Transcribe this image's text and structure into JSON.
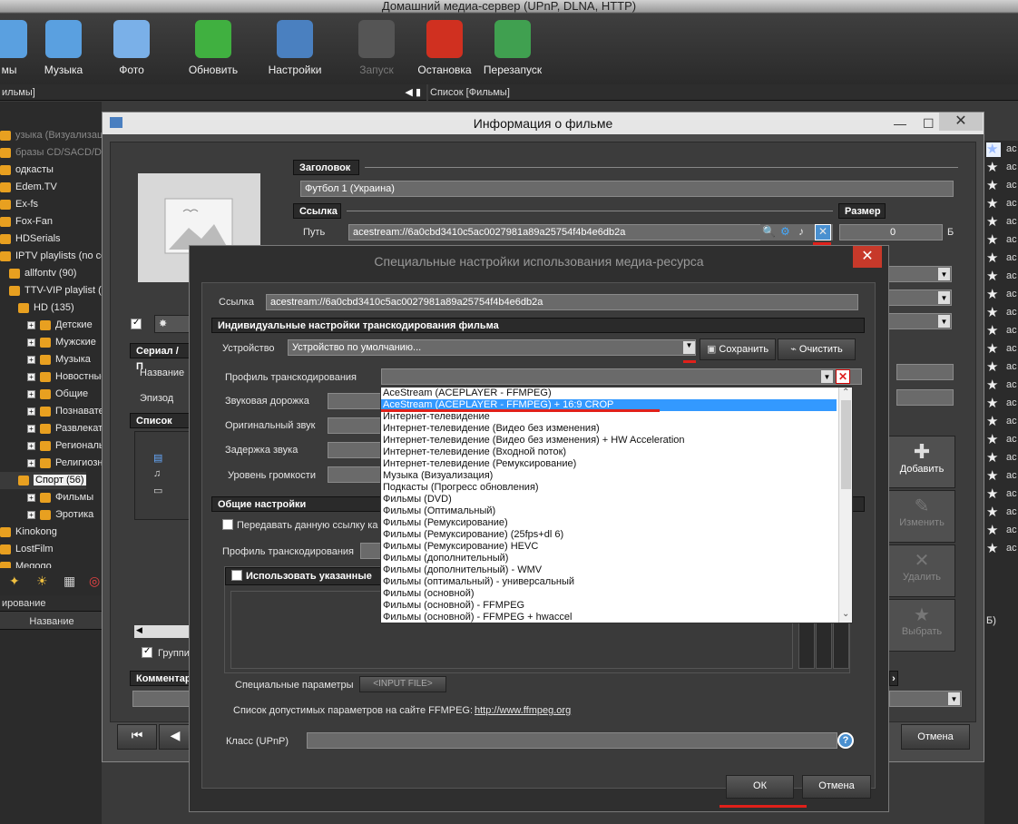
{
  "app_title": "Домашний медиа-сервер (UPnP, DLNA, HTTP)",
  "toolbar": [
    {
      "label": "мы",
      "disabled": false
    },
    {
      "label": "Музыка",
      "disabled": false
    },
    {
      "label": "Фото",
      "disabled": false
    },
    {
      "label": "Обновить",
      "disabled": false
    },
    {
      "label": "Настройки",
      "disabled": false
    },
    {
      "label": "Запуск",
      "disabled": true
    },
    {
      "label": "Остановка",
      "disabled": false
    },
    {
      "label": "Перезапуск",
      "disabled": false
    }
  ],
  "left_panel_title": "ильмы]",
  "right_panel_title": "Список [Фильмы]",
  "tree": [
    "узыка (Визуализация)",
    "бразы CD/SACD/DVD/BD",
    "одкасты",
    "Edem.TV",
    "Ex-fs",
    "Fox-Fan",
    "HDSerials",
    "IPTV playlists (no cons",
    "allfontv (90)",
    "TTV-VIP playlist (n",
    "HD (135)",
    "Детские",
    "Мужские",
    "Музыка",
    "Новостные",
    "Общие",
    "Познаватель",
    "Развлекател",
    "Региональ",
    "Религиозны",
    "Спорт (56)",
    "Фильмы",
    "Эротика",
    "Kinokong",
    "LostFilm",
    "Megogo"
  ],
  "left_bottom": {
    "bar": "ирование",
    "col": "Название"
  },
  "right_list_prefix": "ac",
  "right_bottom": "Б)",
  "movie_dialog": {
    "title": "Информация о фильме",
    "title_header": "Заголовок",
    "title_value": "Футбол 1 (Украина)",
    "link_header": "Ссылка",
    "path_label": "Путь",
    "path_value": "acestream://6a0cbd3410c5ac0027981a89a25754f4b4e6db2a",
    "size_header": "Размер",
    "size_value": "0",
    "size_unit": "Б",
    "serial_header": "Сериал / П",
    "name_label": "Название",
    "episode_label": "Эпизод",
    "list_header": "Список дор",
    "group_label": "Группи",
    "comment_header": "Комментар",
    "cancel": "Отмена",
    "side_buttons": [
      "Добавить",
      "Изменить",
      "Удалить",
      "Выбрать"
    ]
  },
  "special_dialog": {
    "title": "Специальные настройки использования медиа-ресурса",
    "link_label": "Ссылка",
    "link_value": "acestream://6a0cbd3410c5ac0027981a89a25754f4b4e6db2a",
    "indiv_header": "Индивидуальные настройки транскодирования фильма",
    "device_label": "Устройство",
    "device_value": "Устройство по умолчанию...",
    "save": "Сохранить",
    "clear": "Очистить",
    "profile_label": "Профиль транскодирования",
    "audio_track": "Звуковая дорожка",
    "orig_sound": "Оригинальный звук",
    "audio_delay": "Задержка звука",
    "volume": "Уровень громкости",
    "general_header": "Общие настройки",
    "pass_link": "Передавать данную ссылку ка",
    "profile2": "Профиль транскодирования",
    "use_spec": "Использовать указанные",
    "special_params": "Специальные параметры",
    "input_file": "<INPUT FILE>",
    "ffmpeg_text": "Список допустимых параметров на сайте FFMPEG:",
    "ffmpeg_link": "http://www.ffmpeg.org",
    "class_label": "Класс (UPnP)",
    "ok": "ОК",
    "cancel": "Отмена"
  },
  "profiles": [
    "AceStream (ACEPLAYER - FFMPEG)",
    "AceStream (ACEPLAYER - FFMPEG) + 16:9 CROP",
    "Интернет-телевидение",
    "Интернет-телевидение (Видео без изменения)",
    "Интернет-телевидение (Видео без изменения) + HW Acceleration",
    "Интернет-телевидение (Входной поток)",
    "Интернет-телевидение (Ремуксирование)",
    "Музыка (Визуализация)",
    "Подкасты (Прогресс обновления)",
    "Фильмы (DVD)",
    "Фильмы (Оптимальный)",
    "Фильмы (Ремуксирование)",
    "Фильмы (Ремуксирование) (25fps+dl 6)",
    "Фильмы (Ремуксирование) HEVC",
    "Фильмы (дополнительный)",
    "Фильмы (дополнительный) - WMV",
    "Фильмы (оптимальный) - универсальный",
    "Фильмы (основной)",
    "Фильмы (основной) - FFMPEG",
    "Фильмы (основной) - FFMPEG + hwaccel"
  ],
  "selected_profile_index": 1,
  "colors": {
    "accent_red": "#e0201a",
    "selection": "#3399ff",
    "close_red": "#c7392a"
  }
}
